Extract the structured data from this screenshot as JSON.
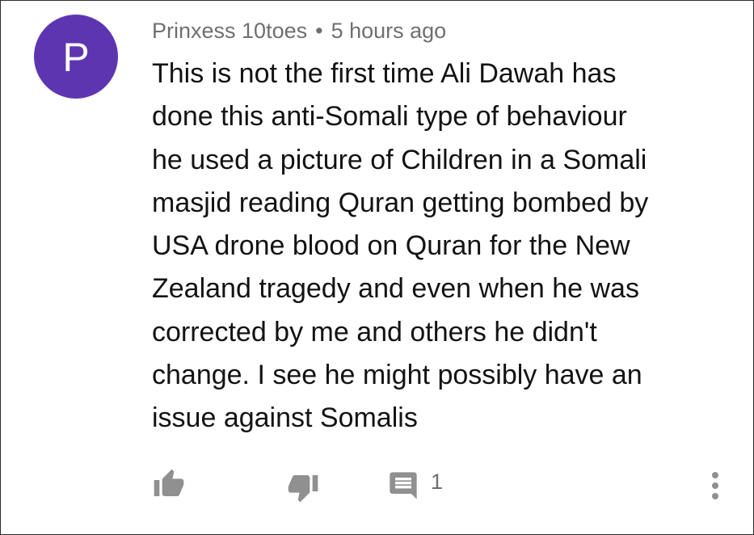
{
  "comment": {
    "avatar_letter": "P",
    "author": "Prinxess 10toes",
    "separator": "•",
    "time": "5 hours ago",
    "text_lines": [
      "This is not the first time Ali Dawah has",
      "done this anti-Somali type of behaviour",
      "he used a picture of Children in a Somali",
      "masjid reading Quran getting bombed by",
      "USA drone blood on Quran for the New",
      "Zealand tragedy and even when he was",
      "corrected by me and others he didn't",
      "change. I see he might possibly have an",
      "issue against Somalis"
    ],
    "reply_count": "1"
  },
  "icons": {
    "like": "thumb-up-icon",
    "dislike": "thumb-down-icon",
    "reply": "comment-icon",
    "more": "more-vert-icon"
  },
  "colors": {
    "avatar_bg": "#5e35b1",
    "meta_text": "#6f6f6f",
    "body_text": "#131313",
    "icon": "#909090"
  }
}
